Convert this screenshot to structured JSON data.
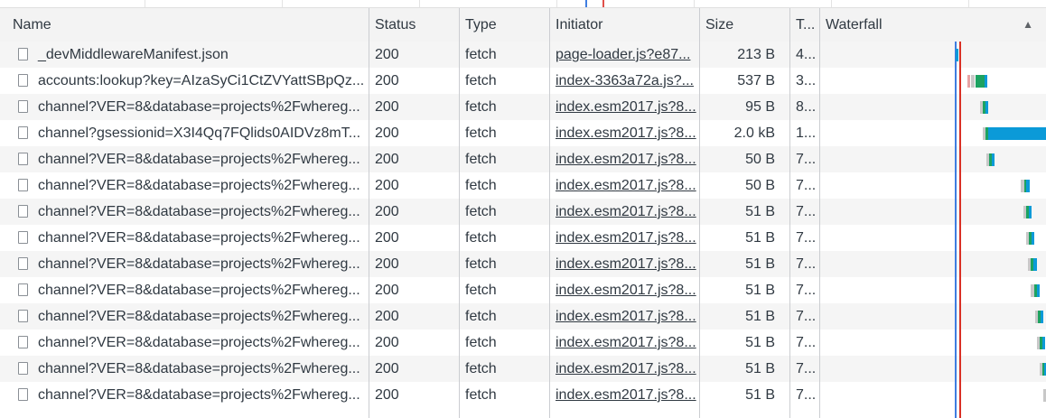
{
  "header": {
    "name": "Name",
    "status": "Status",
    "type": "Type",
    "initiator": "Initiator",
    "size": "Size",
    "time": "T...",
    "waterfall": "Waterfall",
    "sort_icon": "▲"
  },
  "colors": {
    "dom_content_loaded": "#3f7de0",
    "load": "#d93025",
    "waiting": "#1da261",
    "download": "#0b9ad8",
    "queued": "#c8c8c8",
    "stalled": "#e8a4a4"
  },
  "rows": [
    {
      "name": "_devMiddlewareManifest.json",
      "status": "200",
      "type": "fetch",
      "initiator": "page-loader.js?e87...",
      "size": "213 B",
      "time": "4..."
    },
    {
      "name": "accounts:lookup?key=AIzaSyCi1CtZVYattSBpQz...",
      "status": "200",
      "type": "fetch",
      "initiator": "index-3363a72a.js?...",
      "size": "537 B",
      "time": "3..."
    },
    {
      "name": "channel?VER=8&database=projects%2Fwhereg...",
      "status": "200",
      "type": "fetch",
      "initiator": "index.esm2017.js?8...",
      "size": "95 B",
      "time": "8..."
    },
    {
      "name": "channel?gsessionid=X3I4Qq7FQlids0AIDVz8mT...",
      "status": "200",
      "type": "fetch",
      "initiator": "index.esm2017.js?8...",
      "size": "2.0 kB",
      "time": "1..."
    },
    {
      "name": "channel?VER=8&database=projects%2Fwhereg...",
      "status": "200",
      "type": "fetch",
      "initiator": "index.esm2017.js?8...",
      "size": "50 B",
      "time": "7..."
    },
    {
      "name": "channel?VER=8&database=projects%2Fwhereg...",
      "status": "200",
      "type": "fetch",
      "initiator": "index.esm2017.js?8...",
      "size": "50 B",
      "time": "7..."
    },
    {
      "name": "channel?VER=8&database=projects%2Fwhereg...",
      "status": "200",
      "type": "fetch",
      "initiator": "index.esm2017.js?8...",
      "size": "51 B",
      "time": "7..."
    },
    {
      "name": "channel?VER=8&database=projects%2Fwhereg...",
      "status": "200",
      "type": "fetch",
      "initiator": "index.esm2017.js?8...",
      "size": "51 B",
      "time": "7..."
    },
    {
      "name": "channel?VER=8&database=projects%2Fwhereg...",
      "status": "200",
      "type": "fetch",
      "initiator": "index.esm2017.js?8...",
      "size": "51 B",
      "time": "7..."
    },
    {
      "name": "channel?VER=8&database=projects%2Fwhereg...",
      "status": "200",
      "type": "fetch",
      "initiator": "index.esm2017.js?8...",
      "size": "51 B",
      "time": "7..."
    },
    {
      "name": "channel?VER=8&database=projects%2Fwhereg...",
      "status": "200",
      "type": "fetch",
      "initiator": "index.esm2017.js?8...",
      "size": "51 B",
      "time": "7..."
    },
    {
      "name": "channel?VER=8&database=projects%2Fwhereg...",
      "status": "200",
      "type": "fetch",
      "initiator": "index.esm2017.js?8...",
      "size": "51 B",
      "time": "7..."
    },
    {
      "name": "channel?VER=8&database=projects%2Fwhereg...",
      "status": "200",
      "type": "fetch",
      "initiator": "index.esm2017.js?8...",
      "size": "51 B",
      "time": "7..."
    },
    {
      "name": "channel?VER=8&database=projects%2Fwhereg...",
      "status": "200",
      "type": "fetch",
      "initiator": "index.esm2017.js?8...",
      "size": "51 B",
      "time": "7..."
    }
  ]
}
